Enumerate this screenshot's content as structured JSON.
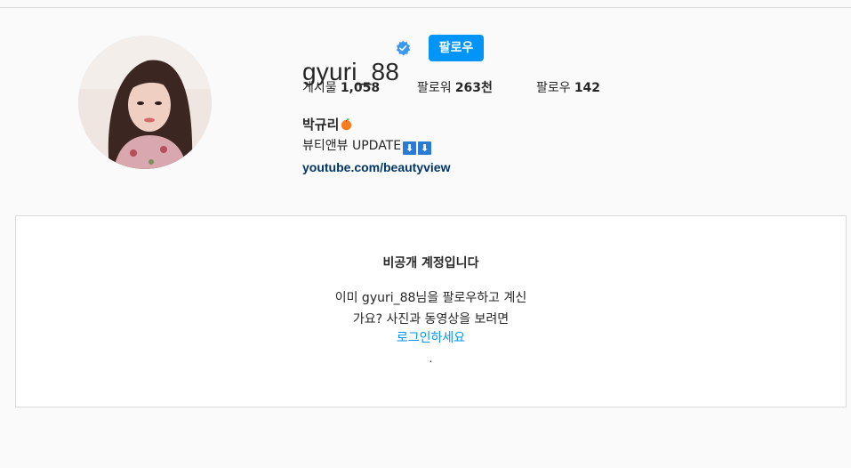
{
  "profile": {
    "username": "gyuri_88",
    "follow_button": "팔로우",
    "stats": {
      "posts_label": "게시물",
      "posts_value": "1,058",
      "followers_label": "팔로워",
      "followers_value": "263천",
      "following_label": "팔로우",
      "following_value": "142"
    },
    "full_name": "박규리",
    "bio": "뷰티앤뷰 UPDATE",
    "bio_arrows": [
      "⬇",
      "⬇"
    ],
    "website": "youtube.com/beautyview"
  },
  "private_notice": {
    "title": "비공개 계정입니다",
    "message_line1": "이미 gyuri_88님을 팔로우하고 계신",
    "message_line2": "가요? 사진과 동영상을 보려면",
    "login_link": "로그인하세요",
    "trailing": "."
  },
  "icons": {
    "verified": "verified-badge-icon",
    "name_emoji": "tangerine-icon",
    "arrow": "down-arrow-icon"
  },
  "colors": {
    "accent": "#0095f6",
    "link": "#00376b",
    "verified": "#3897f0",
    "background": "#fafafa",
    "border": "#dbdbdb"
  }
}
